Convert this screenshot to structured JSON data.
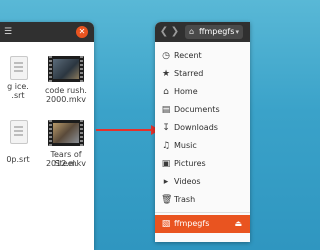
{
  "left_window": {
    "menu_icon": "hamburger-icon",
    "files": [
      {
        "name_line1": "g ice.",
        "name_line2": ".srt",
        "kind": "subtitle"
      },
      {
        "name_line1": "code rush.",
        "name_line2": "2000.mkv",
        "kind": "video"
      },
      {
        "name_line1": "",
        "name_line2": "0p.srt",
        "kind": "subtitle"
      },
      {
        "name_line1": "Tears of Steel.",
        "name_line2": "2012.mkv",
        "kind": "video"
      }
    ]
  },
  "right_window": {
    "path_label": "ffmpegfs",
    "sidebar": [
      {
        "label": "Recent",
        "icon": "clock-icon"
      },
      {
        "label": "Starred",
        "icon": "star-icon"
      },
      {
        "label": "Home",
        "icon": "home-icon"
      },
      {
        "label": "Documents",
        "icon": "document-icon"
      },
      {
        "label": "Downloads",
        "icon": "download-icon"
      },
      {
        "label": "Music",
        "icon": "music-icon"
      },
      {
        "label": "Pictures",
        "icon": "pictures-icon"
      },
      {
        "label": "Videos",
        "icon": "video-icon"
      },
      {
        "label": "Trash",
        "icon": "trash-icon"
      }
    ],
    "mounted": {
      "label": "ffmpegfs",
      "icon": "drive-icon",
      "eject_icon": "eject-icon"
    }
  },
  "colors": {
    "accent": "#e95420",
    "arrow": "#e4312b",
    "titlebar": "#303030"
  }
}
